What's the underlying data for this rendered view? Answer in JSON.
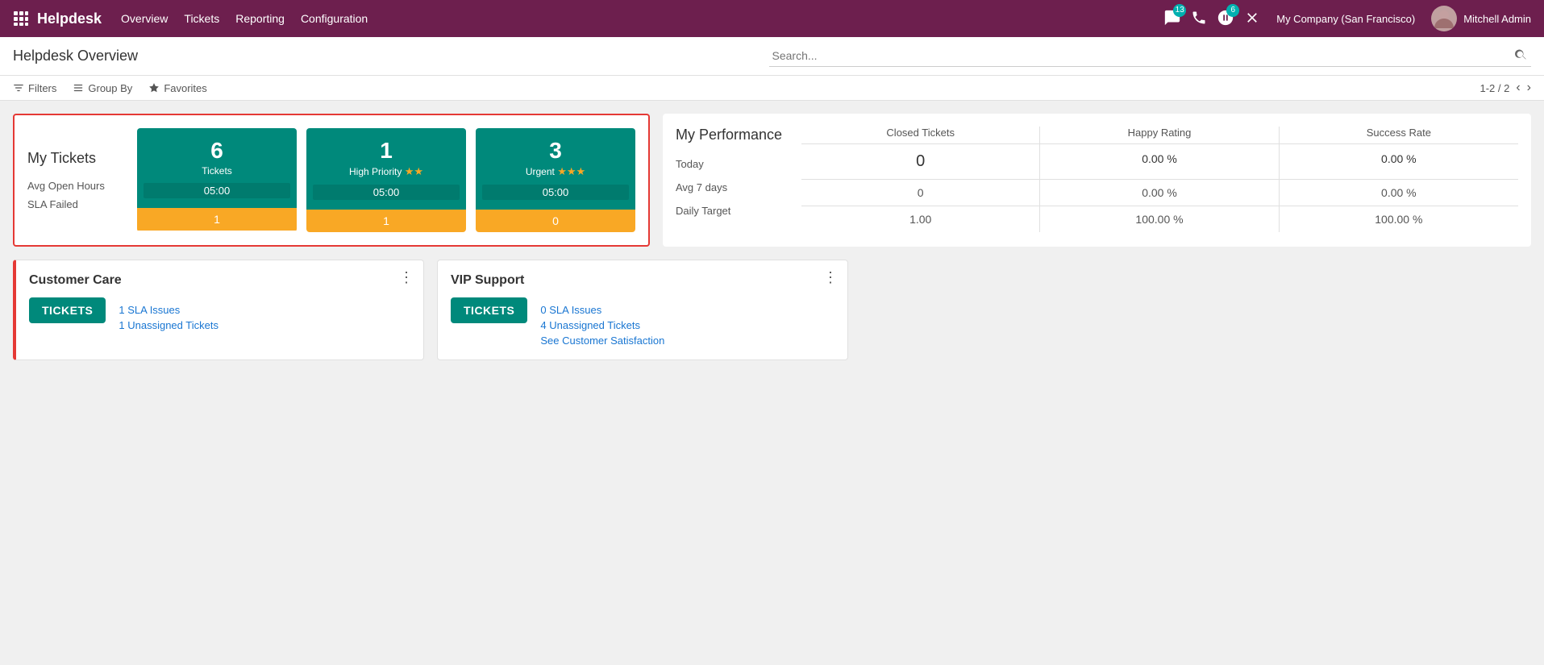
{
  "app": {
    "name": "Helpdesk",
    "nav_items": [
      "Overview",
      "Tickets",
      "Reporting",
      "Configuration"
    ]
  },
  "topbar": {
    "messages_count": "13",
    "phone_label": "Phone",
    "activity_count": "6",
    "company": "My Company (San Francisco)",
    "username": "Mitchell Admin"
  },
  "header": {
    "page_title": "Helpdesk Overview",
    "search_placeholder": "Search...",
    "filters_label": "Filters",
    "groupby_label": "Group By",
    "favorites_label": "Favorites",
    "pagination": "1-2 / 2"
  },
  "my_tickets": {
    "section_label": "My Tickets",
    "avg_open_hours_label": "Avg Open Hours",
    "sla_failed_label": "SLA Failed",
    "cards": [
      {
        "number": "6",
        "label": "Tickets",
        "time": "05:00",
        "sla_failed": "1"
      },
      {
        "number": "1",
        "label": "High Priority",
        "stars": "★★",
        "time": "05:00",
        "sla_failed": "1"
      },
      {
        "number": "3",
        "label": "Urgent",
        "stars": "★★★",
        "time": "05:00",
        "sla_failed": "0"
      }
    ]
  },
  "my_performance": {
    "title": "My Performance",
    "rows": [
      {
        "label": "Today"
      },
      {
        "label": "Avg 7 days"
      },
      {
        "label": "Daily Target"
      }
    ],
    "columns": [
      {
        "header": "Closed Tickets",
        "values": [
          "0",
          "0",
          "1.00"
        ]
      },
      {
        "header": "Happy Rating",
        "values": [
          "0.00 %",
          "0.00 %",
          "100.00 %"
        ]
      },
      {
        "header": "Success Rate",
        "values": [
          "0.00 %",
          "0.00 %",
          "100.00 %"
        ]
      }
    ]
  },
  "kanban_cards": [
    {
      "title": "Customer Care",
      "tickets_btn": "TICKETS",
      "sla_issues": "1 SLA Issues",
      "unassigned": "1 Unassigned Tickets",
      "has_satisfaction": false,
      "red_border": true
    },
    {
      "title": "VIP Support",
      "tickets_btn": "TICKETS",
      "sla_issues": "0 SLA Issues",
      "unassigned": "4 Unassigned Tickets",
      "has_satisfaction": true,
      "satisfaction_link": "See Customer Satisfaction",
      "red_border": false
    }
  ]
}
